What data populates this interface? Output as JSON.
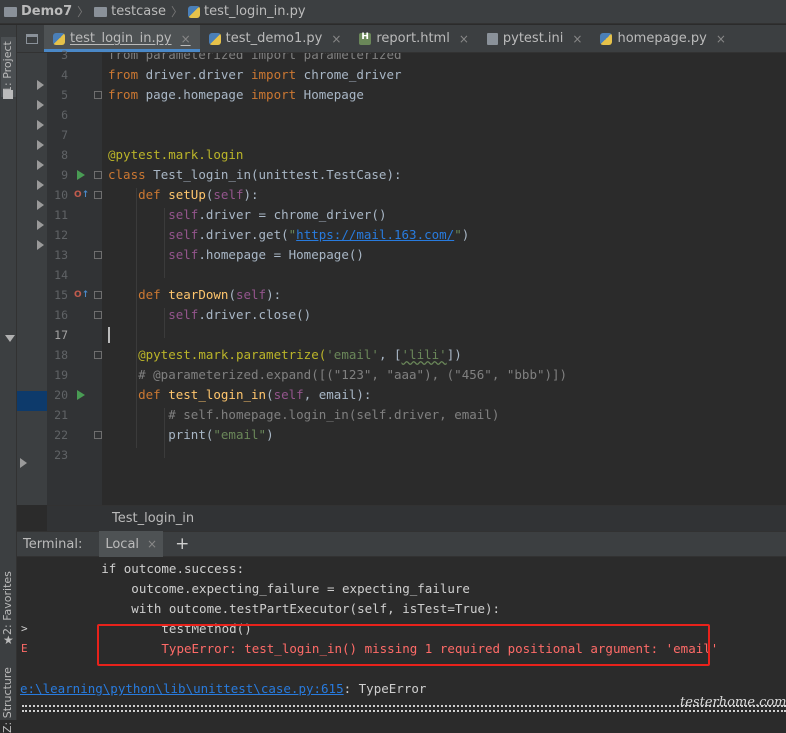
{
  "breadcrumb": {
    "project": "Demo7",
    "folder": "testcase",
    "file": "test_login_in.py"
  },
  "tool_windows": {
    "project": "1: Project",
    "favorites": "2: Favorites",
    "structure": "Z: Structure"
  },
  "tabs": [
    {
      "label": "test_login_in.py",
      "icon": "python-file-icon",
      "active": true
    },
    {
      "label": "test_demo1.py",
      "icon": "python-file-icon",
      "active": false
    },
    {
      "label": "report.html",
      "icon": "html-file-icon",
      "active": false
    },
    {
      "label": "pytest.ini",
      "icon": "ini-file-icon",
      "active": false
    },
    {
      "label": "homepage.py",
      "icon": "python-file-icon",
      "active": false
    }
  ],
  "tab_close_glyph": "×",
  "code": {
    "line_numbers": [
      "3",
      "4",
      "5",
      "6",
      "7",
      "8",
      "9",
      "10",
      "11",
      "12",
      "13",
      "14",
      "15",
      "16",
      "17",
      "18",
      "19",
      "20",
      "21",
      "22",
      "23"
    ],
    "l3": "from parameterized import parameterized",
    "l4": [
      "from",
      " driver.driver ",
      "import",
      " chrome_driver"
    ],
    "l5": [
      "from",
      " page.homepage ",
      "import",
      " Homepage"
    ],
    "l8": "@pytest.mark.login",
    "l9": [
      "class",
      " Test_login_in(unittest.TestCase):"
    ],
    "l10": [
      "def",
      "setUp",
      "(",
      "self",
      "):"
    ],
    "l11": [
      "self",
      ".driver = chrome_driver()"
    ],
    "l12": [
      "self",
      ".driver.get(",
      "\"",
      "https://mail.163.com/",
      "\"",
      ")"
    ],
    "l13": [
      "self",
      ".homepage = Homepage()"
    ],
    "l15": [
      "def",
      "tearDown",
      "(",
      "self",
      "):"
    ],
    "l16": [
      "self",
      ".driver.close()"
    ],
    "l18": [
      "@pytest.mark.parametrize(",
      "'email'",
      ", [",
      "'lili'",
      "])"
    ],
    "l19": "# @parameterized.expand([(\"123\", \"aaa\"), (\"456\", \"bbb\")])",
    "l20": [
      "def",
      "test_login_in",
      "(",
      "self",
      ", email):"
    ],
    "l21": "# self.homepage.login_in(self.driver, email)",
    "l22": [
      "print(",
      "\"email\"",
      ")"
    ]
  },
  "editor_breadcrumb": "Test_login_in",
  "terminal": {
    "title": "Terminal:",
    "tab": "Local",
    "plus": "+",
    "lines": [
      "        if outcome.success:",
      "            outcome.expecting_failure = expecting_failure",
      "            with outcome.testPartExecutor(self, isTest=True):",
      "                testMethod()",
      "                TypeError: test_login_in() missing 1 required positional argument: 'email'"
    ],
    "gutter_marks": [
      ">",
      "E"
    ],
    "link": "e:\\learning\\python\\lib\\unittest\\case.py:615",
    "link_suffix": ": TypeError"
  },
  "watermark": "testerhome.com",
  "colors": {
    "keyword": "#cc7832",
    "decorator": "#bbb529",
    "self": "#94558d",
    "function": "#ffc66d",
    "string": "#6a8759",
    "comment": "#808080",
    "error": "#ff6b68",
    "highlight_box": "#e8221b"
  }
}
